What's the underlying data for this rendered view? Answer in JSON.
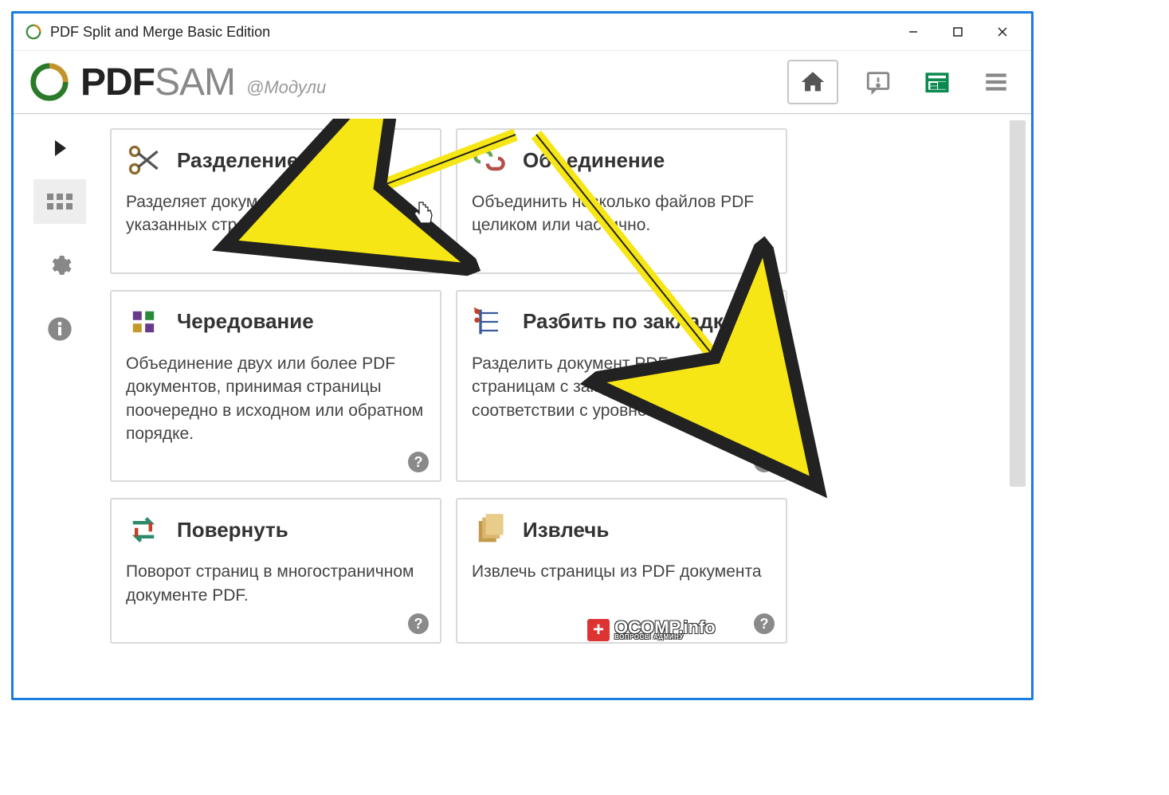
{
  "window": {
    "title": "PDF Split and Merge Basic Edition"
  },
  "header": {
    "logo_pdf": "PDF",
    "logo_sam": "SAM",
    "breadcrumb": "@Модули"
  },
  "tiles": {
    "split": {
      "title": "Разделение",
      "desc": "Разделяет документ PDF на указанных страницах."
    },
    "merge": {
      "title": "Объединение",
      "desc": "Объединить несколько файлов PDF целиком или частично."
    },
    "altmix": {
      "title": "Чередование",
      "desc": "Объединение двух или более PDF документов, принимая страницы поочередно в исходном или обратном порядке."
    },
    "bookmark": {
      "title": "Разбить по закладкам",
      "desc": "Разделить документ PDF по страницам с закладками в соответствии с уровнем закладки"
    },
    "rotate": {
      "title": "Повернуть",
      "desc": "Поворот страниц в многостраничном документе PDF."
    },
    "extract": {
      "title": "Извлечь",
      "desc": "Извлечь страницы из PDF документа"
    }
  },
  "help_glyph": "?",
  "watermark": {
    "main": "OCOMP.info",
    "sub": "ВОПРОСЫ АДМИНУ"
  }
}
